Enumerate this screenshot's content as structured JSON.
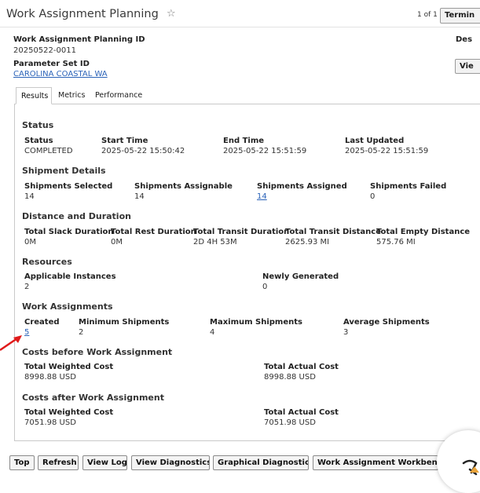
{
  "header": {
    "title": "Work Assignment Planning",
    "star": "☆",
    "pager": "1 of 1",
    "terminate_label": "Termin"
  },
  "summary": {
    "wap_id_label": "Work Assignment Planning ID",
    "wap_id_value": "20250522-0011",
    "param_label": "Parameter Set ID",
    "param_value": "CAROLINA COASTAL WA",
    "desc_label": "Des",
    "view_label": "Vie"
  },
  "tabs": [
    {
      "label": "Results"
    },
    {
      "label": "Metrics"
    },
    {
      "label": "Performance"
    }
  ],
  "status": {
    "heading": "Status",
    "fields": [
      {
        "label": "Status",
        "value": "COMPLETED"
      },
      {
        "label": "Start Time",
        "value": "2025-05-22 15:50:42"
      },
      {
        "label": "End Time",
        "value": "2025-05-22 15:51:59"
      },
      {
        "label": "Last Updated",
        "value": "2025-05-22 15:51:59"
      }
    ]
  },
  "shipment_details": {
    "heading": "Shipment Details",
    "fields": [
      {
        "label": "Shipments Selected",
        "value": "14"
      },
      {
        "label": "Shipments Assignable",
        "value": "14"
      },
      {
        "label": "Shipments Assigned",
        "value": "14"
      },
      {
        "label": "Shipments Failed",
        "value": "0"
      }
    ]
  },
  "distance_duration": {
    "heading": "Distance and Duration",
    "fields": [
      {
        "label": "Total Slack Duration",
        "value": "0M"
      },
      {
        "label": "Total Rest Duration",
        "value": "0M"
      },
      {
        "label": "Total Transit Duration",
        "value": "2D 4H 53M"
      },
      {
        "label": "Total Transit Distance",
        "value": "2625.93 MI"
      },
      {
        "label": "Total Empty Distance",
        "value": "575.76 MI"
      }
    ]
  },
  "resources": {
    "heading": "Resources",
    "fields": [
      {
        "label": "Applicable Instances",
        "value": "2"
      },
      {
        "label": "Newly Generated",
        "value": "0"
      }
    ]
  },
  "work_assignments": {
    "heading": "Work Assignments",
    "fields": [
      {
        "label": "Created",
        "value": "5"
      },
      {
        "label": "Minimum Shipments",
        "value": "2"
      },
      {
        "label": "Maximum Shipments",
        "value": "4"
      },
      {
        "label": "Average Shipments",
        "value": "3"
      }
    ]
  },
  "costs_before": {
    "heading": "Costs before Work Assignment",
    "fields": [
      {
        "label": "Total Weighted Cost",
        "value": "8998.88 USD"
      },
      {
        "label": "Total Actual Cost",
        "value": "8998.88 USD"
      }
    ]
  },
  "costs_after": {
    "heading": "Costs after Work Assignment",
    "fields": [
      {
        "label": "Total Weighted Cost",
        "value": "7051.98 USD"
      },
      {
        "label": "Total Actual Cost",
        "value": "7051.98 USD"
      }
    ]
  },
  "toolbar": {
    "top": "Top",
    "refresh": "Refresh",
    "view_log": "View Log",
    "view_diagnostics": "View Diagnostics",
    "graphical_diagnostics": "Graphical Diagnostics",
    "workbench": "Work Assignment Workbench"
  },
  "colors": {
    "link": "#2a62b8",
    "annotation_arrow": "#e01a1a"
  }
}
